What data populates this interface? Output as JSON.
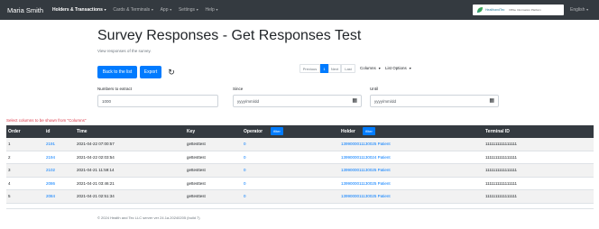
{
  "nav": {
    "brand": "Maria Smith",
    "items": [
      {
        "label": "Holders & Transactions",
        "active": true
      },
      {
        "label": "Cards & Terminals",
        "active": false
      },
      {
        "label": "App",
        "active": false
      },
      {
        "label": "Settings",
        "active": false
      },
      {
        "label": "Help",
        "active": false
      }
    ],
    "logo_word": "HealthandTec",
    "logo_sub": "KBSe Information Platform",
    "language": "English"
  },
  "page": {
    "title": "Survey Responses - Get Responses Test",
    "subtitle": "View responses of the survey."
  },
  "toolbar": {
    "back_label": "Back to the list",
    "export_label": "Export",
    "pager": {
      "prev": "Previous",
      "current": "1",
      "next": "Next",
      "last": "Last"
    },
    "columns_label": "Columns",
    "list_options_label": "List Options"
  },
  "filters": {
    "number_label": "Numbers to extract",
    "number_value": "1000",
    "since_label": "Since",
    "since_placeholder": "yyyy/mm/dd",
    "until_label": "Until",
    "until_placeholder": "yyyy/mm/dd"
  },
  "hint": "Select columns to be shown from \"Columns\"",
  "table": {
    "headers": {
      "order": "Order",
      "id": "id",
      "time": "Time",
      "key": "Key",
      "operator": "Operator",
      "holder": "Holder",
      "terminal": "Terminal ID",
      "filter": "filter"
    },
    "rows": [
      {
        "order": "1",
        "id": "2191",
        "time": "2021-04-22 07:00:57",
        "key": "gettesttest",
        "operator": "0",
        "holder": "1399000011130025 Patient",
        "terminal": "1111111111111111"
      },
      {
        "order": "2",
        "id": "2194",
        "time": "2021-04-22 02:03:54",
        "key": "gettesttest",
        "operator": "0",
        "holder": "1399000011130024 Patient",
        "terminal": "1111111111111111"
      },
      {
        "order": "3",
        "id": "2102",
        "time": "2021-04-21 11:59:14",
        "key": "gettesttest",
        "operator": "0",
        "holder": "1399000011130025 Patient",
        "terminal": "1111111111111111"
      },
      {
        "order": "4",
        "id": "2086",
        "time": "2021-04-21 03:46:21",
        "key": "gettesttest",
        "operator": "0",
        "holder": "1399000011130025 Patient",
        "terminal": "1111111111111111"
      },
      {
        "order": "5",
        "id": "2084",
        "time": "2021-04-21 02:51:34",
        "key": "gettesttest",
        "operator": "0",
        "holder": "1399000011130025 Patient",
        "terminal": "1111111111111111"
      }
    ]
  },
  "footer": "© 2024 Health and Tec LLC server ver 24.1a.20240205 (build 7)",
  "colors": {
    "navbar": "#343a40",
    "primary": "#007bff",
    "hint": "#dc3545"
  }
}
